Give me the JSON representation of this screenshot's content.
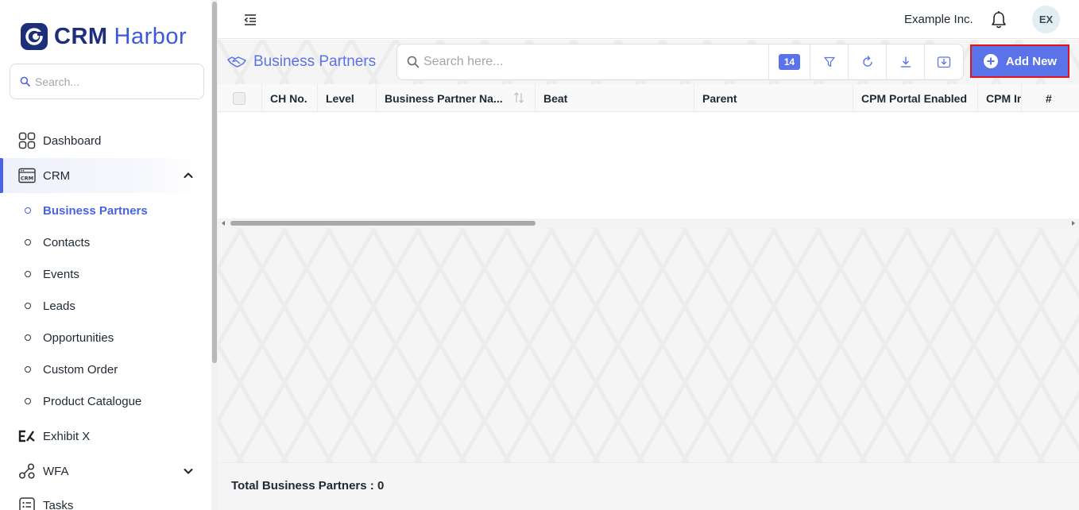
{
  "brand": {
    "name_part1": "CRM",
    "name_part2": "Harbor"
  },
  "sidebar": {
    "search_placeholder": "Search...",
    "items": [
      {
        "label": "Dashboard"
      },
      {
        "label": "CRM"
      },
      {
        "label": "Exhibit X"
      },
      {
        "label": "WFA"
      },
      {
        "label": "Tasks"
      }
    ],
    "crm_sub_items": [
      {
        "label": "Business Partners"
      },
      {
        "label": "Contacts"
      },
      {
        "label": "Events"
      },
      {
        "label": "Leads"
      },
      {
        "label": "Opportunities"
      },
      {
        "label": "Custom Order"
      },
      {
        "label": "Product Catalogue"
      }
    ],
    "crm_icon_text": "CRM"
  },
  "header": {
    "company": "Example Inc.",
    "avatar_initials": "EX"
  },
  "page": {
    "title": "Business Partners",
    "search_placeholder": "Search here...",
    "record_count": "14",
    "add_new_label": "Add New",
    "columns": [
      "CH No.",
      "Level",
      "Business Partner Na...",
      "Beat",
      "Parent",
      "CPM Portal Enabled",
      "CPM In",
      "#"
    ],
    "total_label": "Total Business Partners : 0"
  },
  "colors": {
    "accent": "#5b73e8",
    "brand_dark": "#1d2e7a",
    "highlight_border": "#e0141c"
  }
}
